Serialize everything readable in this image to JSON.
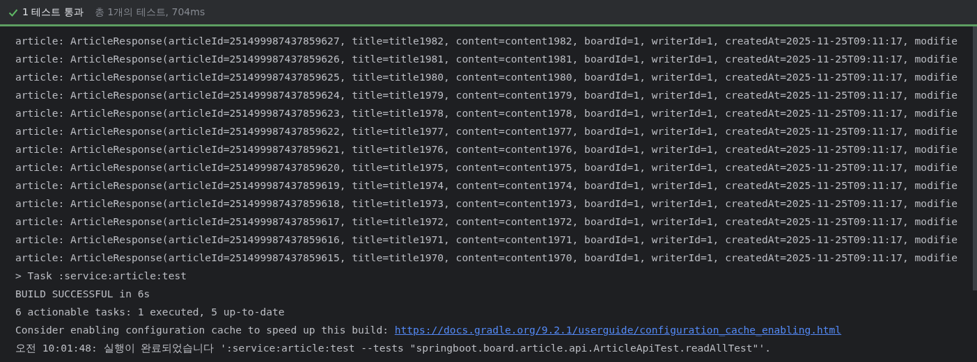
{
  "header": {
    "status": "1 테스트 통과",
    "summary": "총 1개의 테스트, 704ms",
    "passed": true
  },
  "progress": {
    "level": 1
  },
  "console": {
    "lines": [
      {
        "kind": "plain",
        "text": "article: ArticleResponse(articleId=251499987437859627, title=title1982, content=content1982, boardId=1, writerId=1, createdAt=2025-11-25T09:11:17, modifie"
      },
      {
        "kind": "plain",
        "text": "article: ArticleResponse(articleId=251499987437859626, title=title1981, content=content1981, boardId=1, writerId=1, createdAt=2025-11-25T09:11:17, modifie"
      },
      {
        "kind": "plain",
        "text": "article: ArticleResponse(articleId=251499987437859625, title=title1980, content=content1980, boardId=1, writerId=1, createdAt=2025-11-25T09:11:17, modifie"
      },
      {
        "kind": "plain",
        "text": "article: ArticleResponse(articleId=251499987437859624, title=title1979, content=content1979, boardId=1, writerId=1, createdAt=2025-11-25T09:11:17, modifie"
      },
      {
        "kind": "plain",
        "text": "article: ArticleResponse(articleId=251499987437859623, title=title1978, content=content1978, boardId=1, writerId=1, createdAt=2025-11-25T09:11:17, modifie"
      },
      {
        "kind": "plain",
        "text": "article: ArticleResponse(articleId=251499987437859622, title=title1977, content=content1977, boardId=1, writerId=1, createdAt=2025-11-25T09:11:17, modifie"
      },
      {
        "kind": "plain",
        "text": "article: ArticleResponse(articleId=251499987437859621, title=title1976, content=content1976, boardId=1, writerId=1, createdAt=2025-11-25T09:11:17, modifie"
      },
      {
        "kind": "plain",
        "text": "article: ArticleResponse(articleId=251499987437859620, title=title1975, content=content1975, boardId=1, writerId=1, createdAt=2025-11-25T09:11:17, modifie"
      },
      {
        "kind": "plain",
        "text": "article: ArticleResponse(articleId=251499987437859619, title=title1974, content=content1974, boardId=1, writerId=1, createdAt=2025-11-25T09:11:17, modifie"
      },
      {
        "kind": "plain",
        "text": "article: ArticleResponse(articleId=251499987437859618, title=title1973, content=content1973, boardId=1, writerId=1, createdAt=2025-11-25T09:11:17, modifie"
      },
      {
        "kind": "plain",
        "text": "article: ArticleResponse(articleId=251499987437859617, title=title1972, content=content1972, boardId=1, writerId=1, createdAt=2025-11-25T09:11:17, modifie"
      },
      {
        "kind": "plain",
        "text": "article: ArticleResponse(articleId=251499987437859616, title=title1971, content=content1971, boardId=1, writerId=1, createdAt=2025-11-25T09:11:17, modifie"
      },
      {
        "kind": "plain",
        "text": "article: ArticleResponse(articleId=251499987437859615, title=title1970, content=content1970, boardId=1, writerId=1, createdAt=2025-11-25T09:11:17, modifie"
      },
      {
        "kind": "plain",
        "text": "> Task :service:article:test"
      },
      {
        "kind": "plain",
        "text": "BUILD SUCCESSFUL in 6s"
      },
      {
        "kind": "plain",
        "text": "6 actionable tasks: 1 executed, 5 up-to-date"
      },
      {
        "kind": "link",
        "text": "Consider enabling configuration cache to speed up this build:",
        "link": "https://docs.gradle.org/9.2.1/userguide/configuration_cache_enabling.html"
      },
      {
        "kind": "plain",
        "text": "오전 10:01:48: 실행이 완료되었습니다 ':service:article:test --tests \"springboot.board.article.api.ArticleApiTest.readAllTest\"'."
      }
    ]
  }
}
